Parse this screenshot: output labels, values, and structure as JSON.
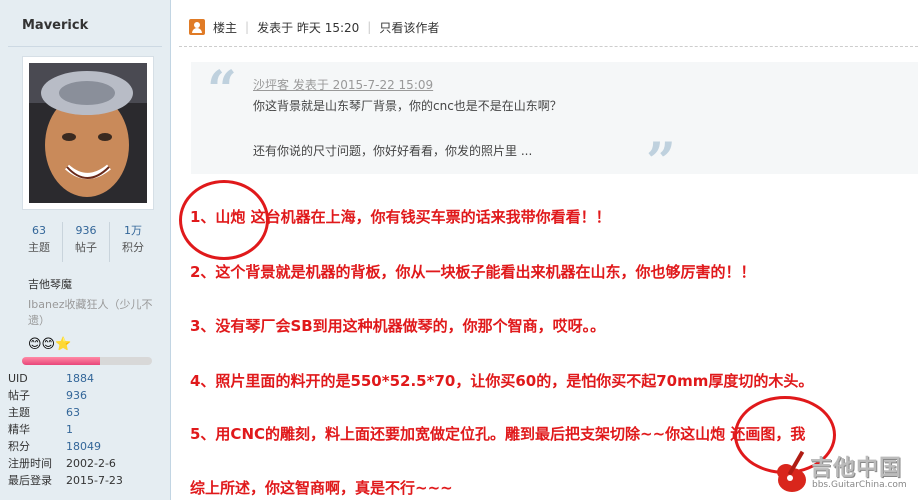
{
  "user": {
    "name": "Maverick",
    "stats": [
      {
        "value": "63",
        "label": "主题"
      },
      {
        "value": "936",
        "label": "帖子"
      },
      {
        "value": "1万",
        "label": "积分"
      }
    ],
    "group": "吉他琴魔",
    "custom_title": "Ibanez收藏狂人（少儿不遗）",
    "medals": "😊😊⭐",
    "level_progress": 0.6,
    "profile": [
      {
        "key": "UID",
        "value": "1884"
      },
      {
        "key": "帖子",
        "value": "936"
      },
      {
        "key": "主题",
        "value": "63"
      },
      {
        "key": "精华",
        "value": "1"
      },
      {
        "key": "积分",
        "value": "18049"
      },
      {
        "key": "注册时间",
        "value": "2002-2-6"
      },
      {
        "key": "最后登录",
        "value": "2015-7-23"
      }
    ]
  },
  "post_meta": {
    "role": "楼主",
    "posted": "发表于 昨天 15:20",
    "author_only": "只看该作者"
  },
  "quote": {
    "author": "沙坪客 发表于 2015-7-22 15:09",
    "line1": "你这背景就是山东琴厂背景，你的cnc也是不是在山东啊？",
    "line2": "还有你说的尺寸问题，你好好看看，你发的照片里 ..."
  },
  "points": [
    "1、山炮   这台机器在上海，你有钱买车票的话来我带你看看！！",
    "2、这个背景就是机器的背板，你从一块板子能看出来机器在山东，你也够厉害的！！",
    "3、没有琴厂会SB到用这种机器做琴的，你那个智商，哎呀。。",
    "4、照片里面的料开的是550*52.5*70，让你买60的，是怕你买不起70mm厚度切的木头。",
    "5、用CNC的雕刻，料上面还要加宽做定位孔。雕到最后把支架切除~~你这山炮   还画图，我",
    "综上所述，你这智商啊，真是不行~~~"
  ],
  "watermark": {
    "title": "吉他中国",
    "url": "bbs.GuitarChina.com"
  }
}
